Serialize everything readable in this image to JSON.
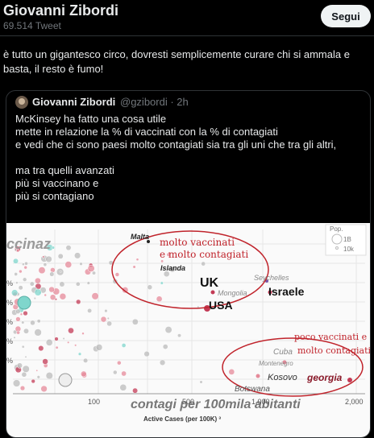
{
  "header": {
    "title": "Giovanni Zibordi",
    "subtitle": "69.514 Tweet",
    "follow_label": "Segui"
  },
  "tweet": {
    "text": "è tutto un gigantesco circo, dovresti semplicemente curare chi si ammala e basta, il resto è fumo!"
  },
  "quote": {
    "author": "Giovanni Zibordi",
    "handle": "@gzibordi · 2h",
    "text": "McKinsey ha fatto una cosa utile\nmette in relazione la % di vaccinati con la % di contagiati\ne vedi che ci sono paesi molto contagiati sia tra gli uni che tra gli altri,\n\nma tra quelli avanzati\npiù si vaccinano e\npiù si contagiano"
  },
  "chart_data": {
    "type": "scatter",
    "xlabel": "Active Cases (per 100K) ³",
    "x_ticks": [
      "100",
      "500",
      "1,000",
      "2,000"
    ],
    "y_ticks": [
      "%",
      "%",
      "%",
      "%",
      "%"
    ],
    "legend": {
      "title": "Pop.",
      "items": [
        "1B",
        "10k"
      ]
    },
    "partial_label": "ccinaz",
    "country_labels": [
      {
        "text": "Malta",
        "color": "#222222"
      },
      {
        "text": "Islanda",
        "color": "#222222"
      },
      {
        "text": "Mongolia",
        "color": "#888888"
      },
      {
        "text": "Seychelles",
        "color": "#888888"
      },
      {
        "text": "Cuba",
        "color": "#888888"
      },
      {
        "text": "Montenegro",
        "color": "#888888"
      },
      {
        "text": "Botswana",
        "color": "#555555"
      }
    ],
    "handwritten": [
      {
        "text": "molto vaccinati",
        "color": "#c0232b"
      },
      {
        "text": "e molto contagiati",
        "color": "#c0232b"
      },
      {
        "text": "UK",
        "color": "#111111"
      },
      {
        "text": "Israele",
        "color": "#111111"
      },
      {
        "text": "USA",
        "color": "#111111"
      },
      {
        "text": "poco vaccinati e",
        "color": "#c0232b"
      },
      {
        "text": "molto contagiati",
        "color": "#c0232b"
      },
      {
        "text": "Kosovo",
        "color": "#333333"
      },
      {
        "text": "georgia",
        "color": "#8a1a2a"
      },
      {
        "text": "contagi per 100mila abitanti",
        "color": "#777777"
      }
    ],
    "colors": {
      "pink": "#e58a9a",
      "red": "#c33a55",
      "gray": "#bbbbbb",
      "teal": "#7fd6cc",
      "ellipse": "#c0232b"
    }
  }
}
